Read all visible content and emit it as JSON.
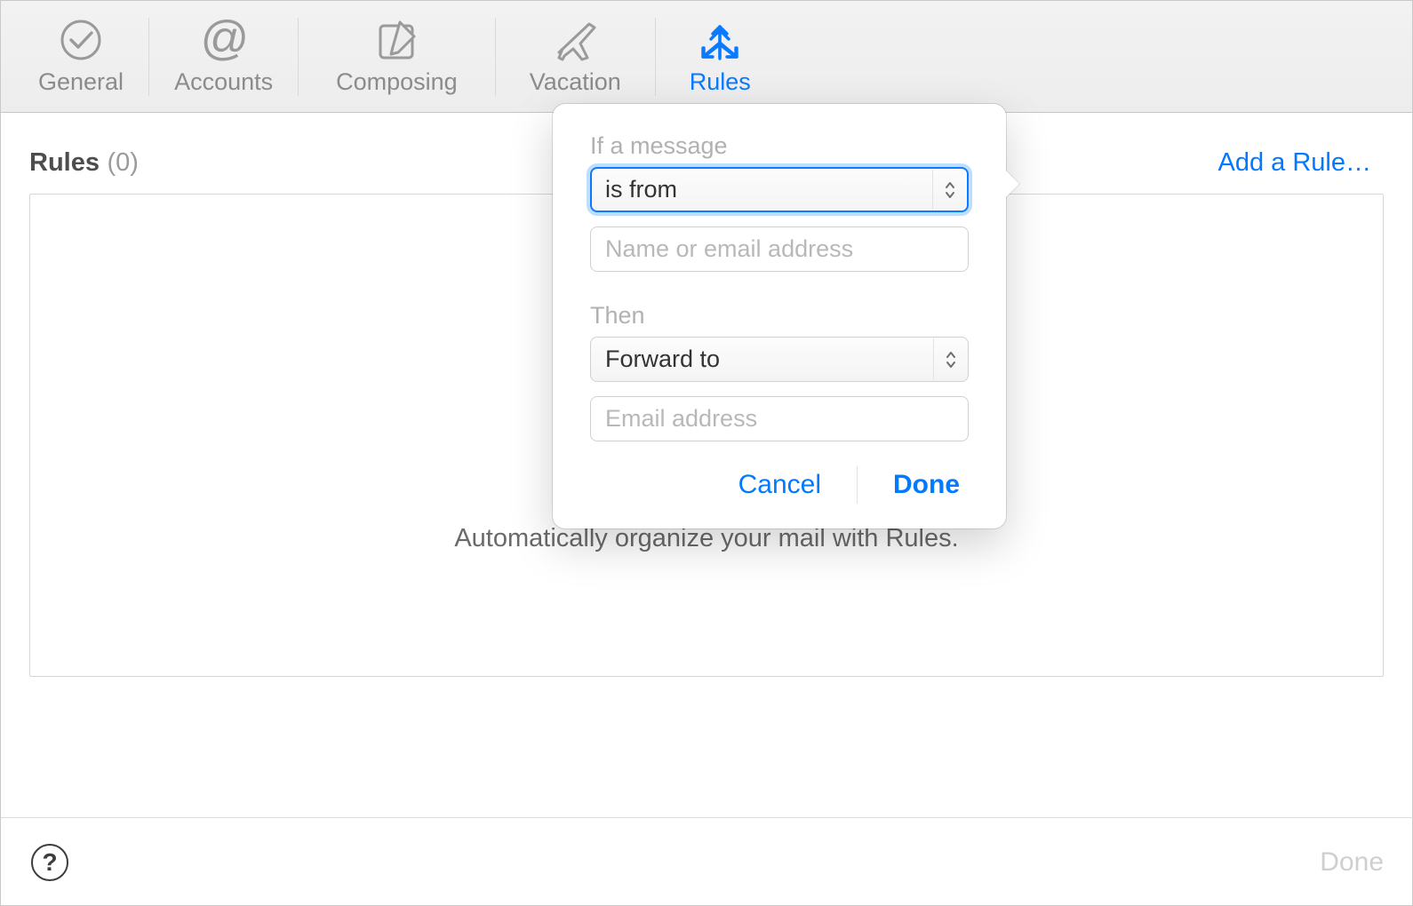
{
  "tabs": {
    "general": {
      "label": "General"
    },
    "accounts": {
      "label": "Accounts"
    },
    "composing": {
      "label": "Composing"
    },
    "vacation": {
      "label": "Vacation"
    },
    "rules": {
      "label": "Rules"
    }
  },
  "rules_panel": {
    "title": "Rules",
    "count_display": "(0)",
    "add_rule_label": "Add a Rule…",
    "empty_state_text": "Automatically organize your mail with Rules."
  },
  "rule_popover": {
    "condition_label": "If a message",
    "condition_value": "is from",
    "condition_input_placeholder": "Name or email address",
    "action_label": "Then",
    "action_value": "Forward to",
    "action_input_placeholder": "Email address",
    "cancel_label": "Cancel",
    "done_label": "Done"
  },
  "footer": {
    "help_symbol": "?",
    "done_label": "Done"
  },
  "colors": {
    "accent": "#017aff"
  }
}
